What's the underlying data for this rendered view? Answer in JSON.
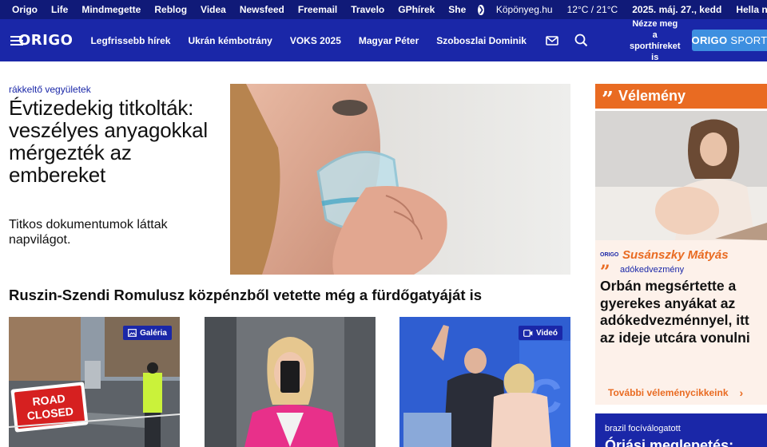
{
  "topbar": {
    "links": [
      "Origo",
      "Life",
      "Mindmegette",
      "Reblog",
      "Videa",
      "Newsfeed",
      "Freemail",
      "Travelo",
      "GPhírek",
      "She"
    ],
    "weather_site": "Köpönyeg.hu",
    "temperature": "12°C / 21°C",
    "date": "2025. máj. 27., kedd",
    "nameday": "Hella névnapja"
  },
  "header": {
    "logo": "ORIGO",
    "nav": [
      "Legfrissebb hírek",
      "Ukrán kémbotrány",
      "VOKS 2025",
      "Magyar Péter",
      "Szoboszlai Dominik"
    ],
    "sport_prompt_line1": "Nézze meg a",
    "sport_prompt_line2": "sporthíreket is",
    "sport_button_bold": "ORIGO",
    "sport_button_light": "SPORT"
  },
  "lead": {
    "kicker": "rákkeltő vegyületek",
    "title": "Évtizedekig titkolták: veszélyes anyagokkal mérgezték az embereket",
    "lead": "Titkos dokumentumok láttak napvilágot."
  },
  "second": {
    "title": "Ruszin-Szendi Romulusz közpénzből vetette még a fürdőgatyáját is"
  },
  "thumbs": [
    {
      "badge": "Galéria",
      "sign_line1": "ROAD",
      "sign_line2": "CLOSED"
    },
    {
      "badge": ""
    },
    {
      "badge": "Videó"
    }
  ],
  "opinion": {
    "heading": "Vélemény",
    "mini_logo": "ORIGO",
    "author": "Susánszky Mátyás",
    "kicker": "adókedvezmény",
    "title": "Orbán megsértette a gyerekes anyákat az adókedvezménnyel, itt az ideje utcára vonulni",
    "more": "További véleménycikkeink"
  },
  "next_card": {
    "kicker": "brazil focíválogatott",
    "title": "Óriási meglepetés:"
  },
  "colors": {
    "brand_blue": "#1a27a8",
    "topbar_blue": "#101a78",
    "opinion_orange": "#e96b22",
    "sport_button": "#3d8fe0"
  }
}
